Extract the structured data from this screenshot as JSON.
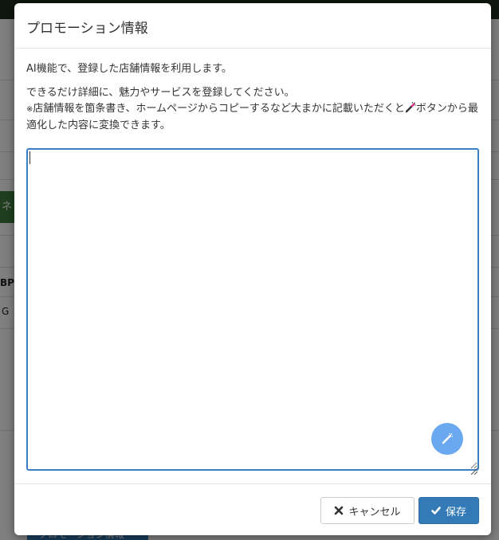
{
  "background": {
    "side_label_1": "ネ",
    "side_label_2": "BP",
    "side_label_3": "G",
    "bottom_button": "プロモーション情報"
  },
  "modal": {
    "title": "プロモーション情報",
    "description_1": "AI機能で、登録した店舗情報を利用します。",
    "description_2": "できるだけ詳細に、魅力やサービスを登録してください。",
    "note_mark": "※",
    "note_text_1": "店舗情報を箇条書き、ホームページからコピーするなど大まかに記載いただくと",
    "note_text_2": "ボタンから最適化した内容に変換できます。",
    "textarea": {
      "value": "",
      "placeholder": ""
    },
    "ai_button_icon": "magic-wand-icon",
    "cancel_label": "キャンセル",
    "save_label": "保存"
  },
  "colors": {
    "primary": "#337ab7",
    "focus_border": "#3b7fc4",
    "ai_button": "#6aa9f0"
  }
}
